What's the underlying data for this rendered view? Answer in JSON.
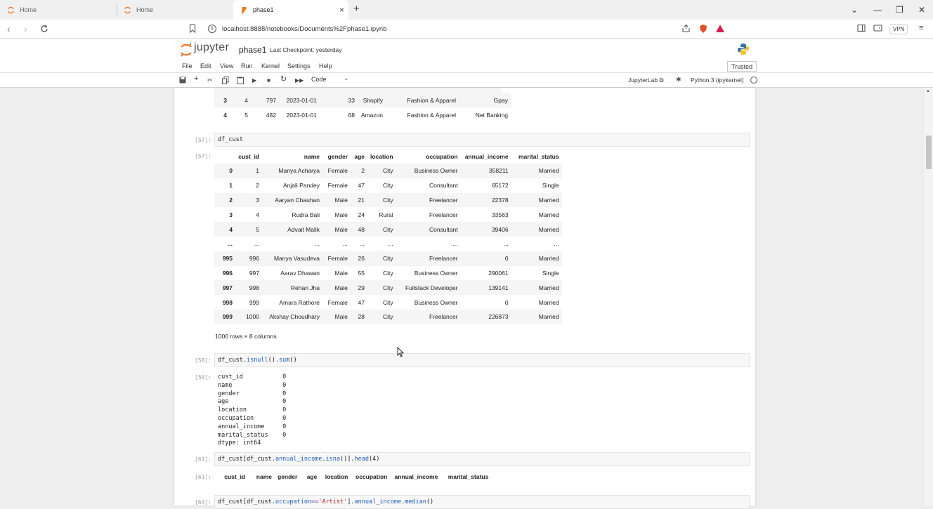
{
  "browser": {
    "tabs": [
      {
        "label": "Home",
        "active": false
      },
      {
        "label": "Home",
        "active": false
      },
      {
        "label": "phase1",
        "active": true
      }
    ],
    "url": "localhost:8888/notebooks/Documents%2Fphase1.ipynb",
    "vpn_label": "VPN"
  },
  "jupyter": {
    "brand": "jupyter",
    "notebook_name": "phase1",
    "checkpoint": "Last Checkpoint: yesterday",
    "menu": [
      "File",
      "Edit",
      "View",
      "Run",
      "Kernel",
      "Settings",
      "Help"
    ],
    "trusted": "Trusted",
    "cell_type": "Code",
    "jupyterlab_link": "JupyterLab",
    "kernel": "Python 3 (ipykernel)"
  },
  "top_partial_table": {
    "rows": [
      [
        "3",
        "4",
        "797",
        "2023-01-01",
        "33",
        "Shopify",
        "Fashion & Apparel",
        "Gpay"
      ],
      [
        "4",
        "5",
        "482",
        "2023-01-01",
        "68",
        "Amazon",
        "Fashion & Apparel",
        "Net Banking"
      ]
    ]
  },
  "cells": {
    "c57": {
      "in_prompt": "[57]:",
      "out_prompt": "[57]:",
      "code": "df_cust",
      "columns": [
        "",
        "cust_id",
        "name",
        "gender",
        "age",
        "location",
        "occupation",
        "annual_income",
        "marital_status"
      ],
      "rows": [
        [
          "0",
          "1",
          "Manya Acharya",
          "Female",
          "2",
          "City",
          "Business Owner",
          "358211",
          "Married"
        ],
        [
          "1",
          "2",
          "Anjali Pandey",
          "Female",
          "47",
          "City",
          "Consultant",
          "65172",
          "Single"
        ],
        [
          "2",
          "3",
          "Aaryan Chauhan",
          "Male",
          "21",
          "City",
          "Freelancer",
          "22378",
          "Married"
        ],
        [
          "3",
          "4",
          "Rudra Bali",
          "Male",
          "24",
          "Rural",
          "Freelancer",
          "33563",
          "Married"
        ],
        [
          "4",
          "5",
          "Advait Malik",
          "Male",
          "48",
          "City",
          "Consultant",
          "39406",
          "Married"
        ],
        [
          "...",
          "...",
          "...",
          "...",
          "...",
          "...",
          "...",
          "...",
          "..."
        ],
        [
          "995",
          "996",
          "Manya Vasudeva",
          "Female",
          "26",
          "City",
          "Freelancer",
          "0",
          "Married"
        ],
        [
          "996",
          "997",
          "Aarav Dhawan",
          "Male",
          "55",
          "City",
          "Business Owner",
          "290061",
          "Single"
        ],
        [
          "997",
          "998",
          "Rehan Jha",
          "Male",
          "29",
          "City",
          "Fullstack Developer",
          "139141",
          "Married"
        ],
        [
          "998",
          "999",
          "Amara Rathore",
          "Female",
          "47",
          "City",
          "Business Owner",
          "0",
          "Married"
        ],
        [
          "999",
          "1000",
          "Akshay Choudhary",
          "Male",
          "28",
          "City",
          "Freelancer",
          "226873",
          "Married"
        ]
      ],
      "shape_note": "1000 rows × 8 columns"
    },
    "c58": {
      "in_prompt": "[58]:",
      "out_prompt": "[58]:",
      "code_obj": "df_cust.",
      "code_fn1": "isnull",
      "code_mid": "().",
      "code_fn2": "sum",
      "code_end": "()",
      "output": "cust_id           0\nname              0\ngender            0\nage               0\nlocation          0\noccupation        0\nannual_income     0\nmarital_status    0\ndtype: int64"
    },
    "c61": {
      "in_prompt": "[61]:",
      "out_prompt": "[61]:",
      "code_a": "df_cust[df_cust.",
      "code_b": "annual_income",
      "code_c": ".",
      "code_d": "isna",
      "code_e": "()].",
      "code_f": "head",
      "code_g": "(4)",
      "columns": [
        "cust_id",
        "name",
        "gender",
        "age",
        "location",
        "occupation",
        "annual_income",
        "marital_status"
      ]
    },
    "c64": {
      "in_prompt": "[64]:",
      "code_a": "df_cust[df_cust.",
      "code_b": "occupation",
      "code_c": "==",
      "code_d": "'Artist'",
      "code_e": "].",
      "code_f": "annual_income",
      "code_g": ".",
      "code_h": "median",
      "code_i": "()"
    }
  },
  "colors": {
    "jupyter_orange": "#f37726",
    "link_blue": "#1f5fb5",
    "string_red": "#b3262e"
  }
}
